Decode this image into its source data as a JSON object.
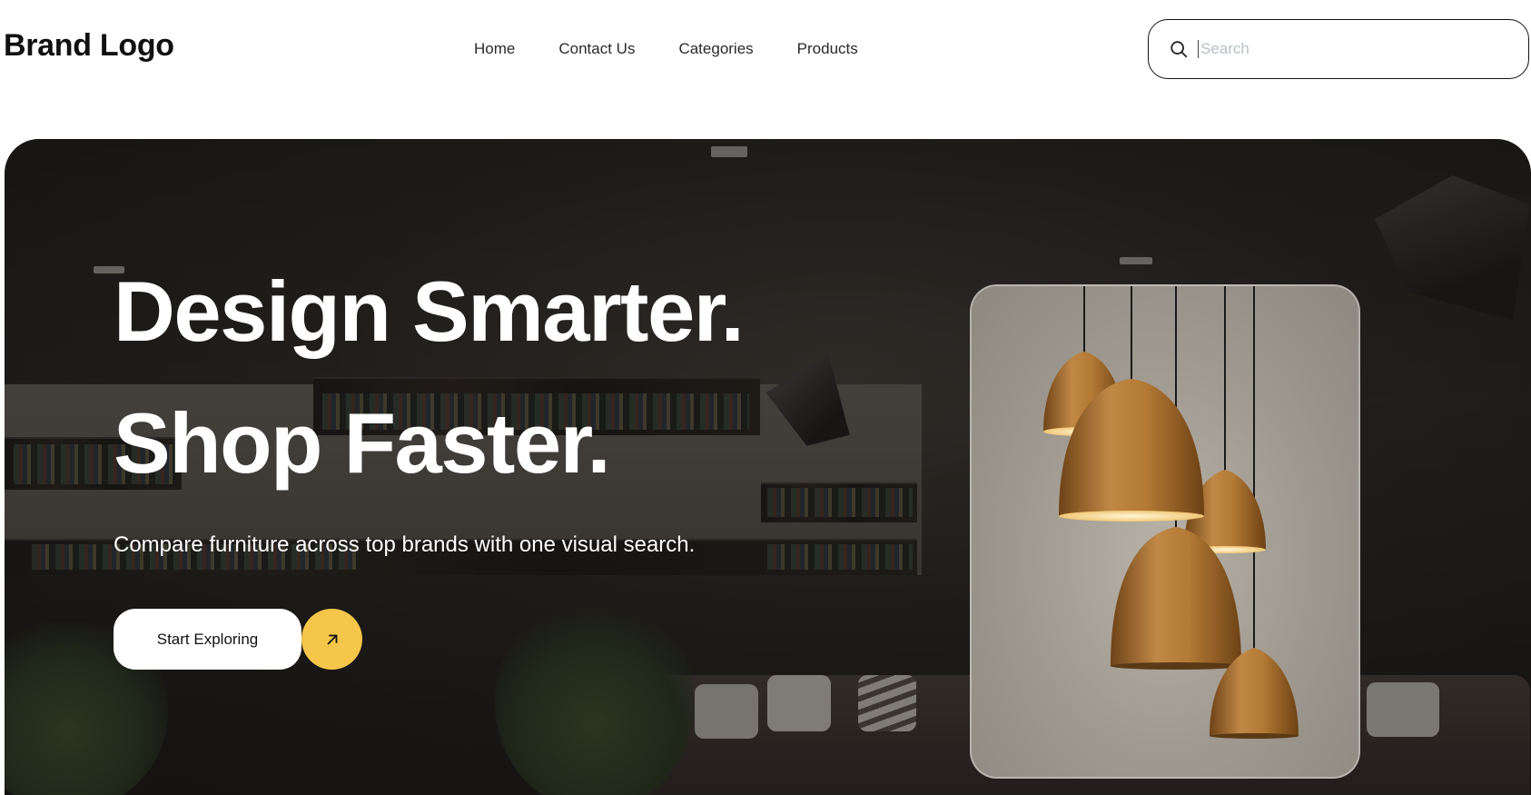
{
  "header": {
    "brand": "Brand Logo",
    "nav": [
      {
        "label": "Home"
      },
      {
        "label": "Contact Us"
      },
      {
        "label": "Categories"
      },
      {
        "label": "Products"
      }
    ],
    "search": {
      "placeholder": "Search",
      "value": "",
      "icon": "search-icon"
    }
  },
  "hero": {
    "title_line1": "Design Smarter.",
    "title_line2": "Shop Faster.",
    "subtitle": "Compare furniture across top brands with one visual search.",
    "cta_label": "Start Exploring",
    "cta_icon": "arrow-up-right-icon",
    "product_image": "pendant-lamps-image"
  },
  "colors": {
    "accent": "#f6c64a",
    "text_dark": "#111111",
    "hero_text": "#ffffff",
    "lamp_copper": "#b07836"
  }
}
